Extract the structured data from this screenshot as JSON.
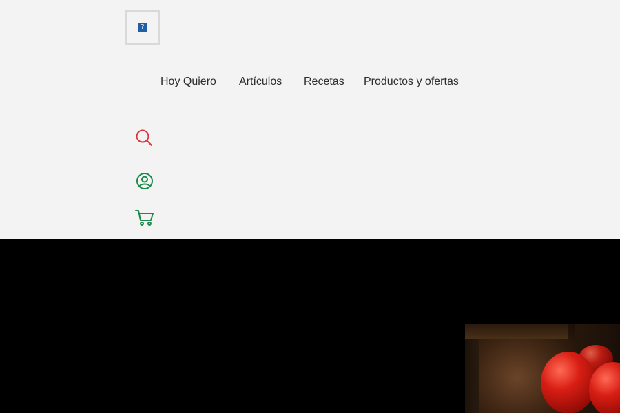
{
  "header": {
    "logo": {
      "alt_glyph": "?",
      "icon": "broken-image-icon"
    },
    "nav": [
      {
        "label": "Hoy Quiero"
      },
      {
        "label": "Artículos"
      },
      {
        "label": "Recetas"
      },
      {
        "label": "Productos y ofertas"
      }
    ],
    "icons": {
      "search": {
        "name": "search-icon",
        "color": "#d9363e"
      },
      "account": {
        "name": "user-circle-icon",
        "color": "#1a8a4a"
      },
      "cart": {
        "name": "cart-icon",
        "color": "#1a8a4a"
      }
    },
    "background": "#f3f3f3"
  },
  "hero": {
    "background": "#000000",
    "image": "tomatoes-in-wooden-bowl"
  }
}
